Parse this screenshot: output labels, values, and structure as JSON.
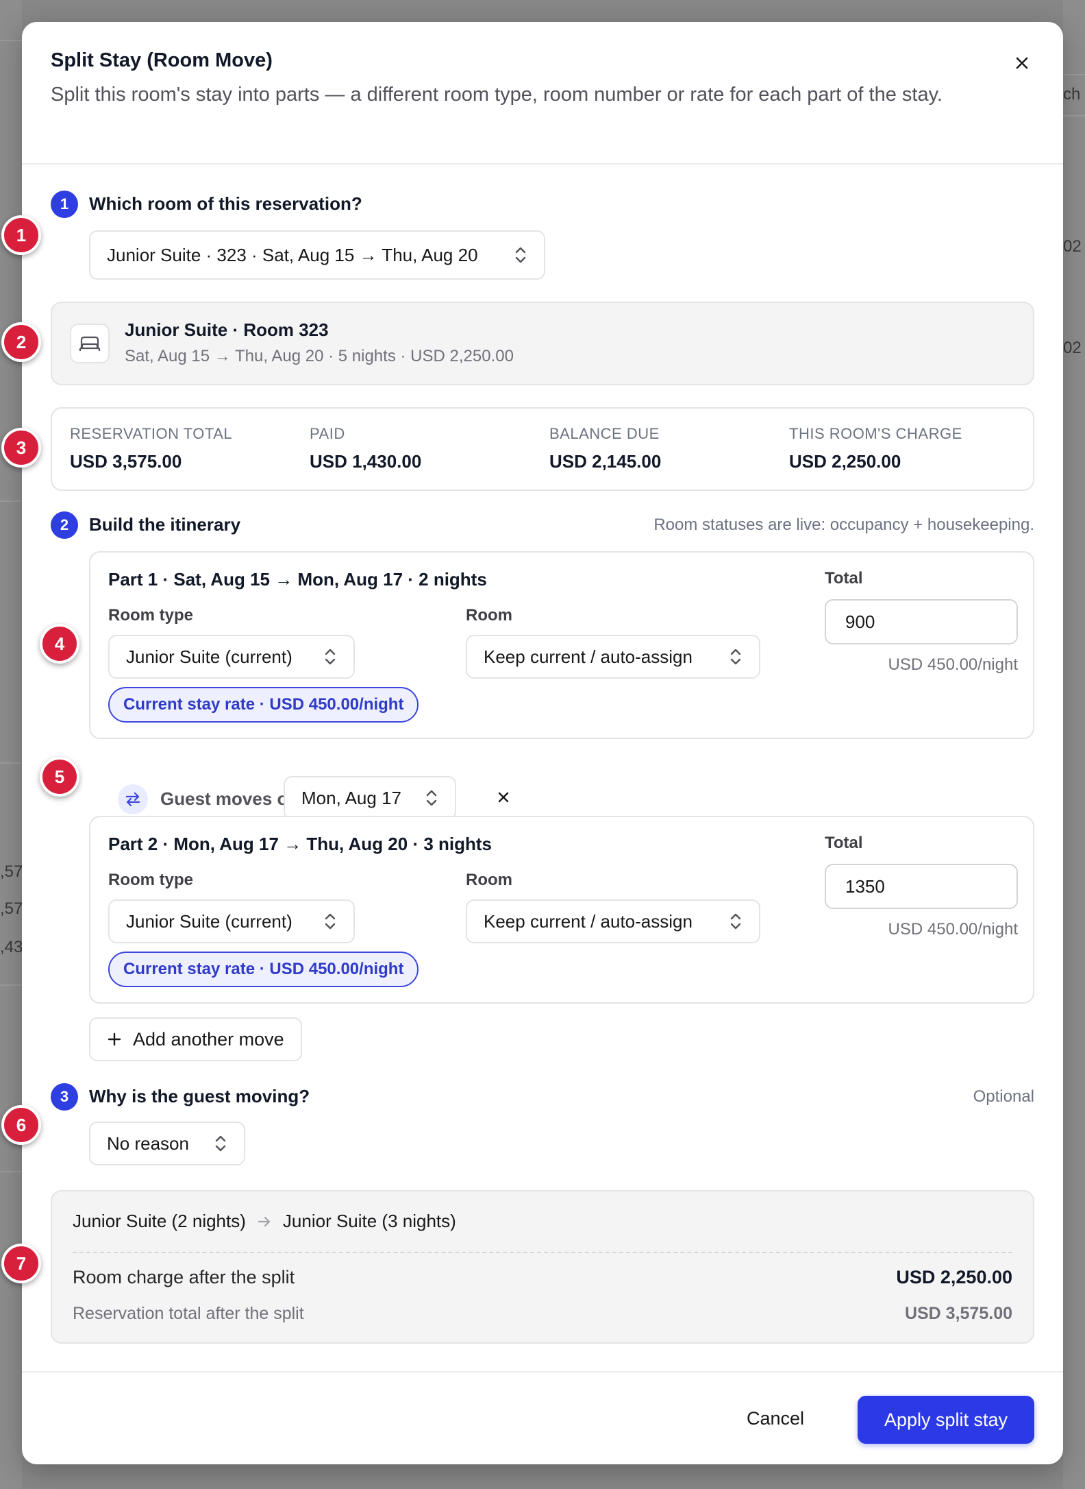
{
  "background": {
    "fragments": [
      "ch",
      "02",
      "02",
      ",57",
      ",57",
      ",43"
    ]
  },
  "modal": {
    "title": "Split Stay (Room Move)",
    "subtitle": "Split this room's stay into parts — a different room type, room number or rate for each part of the stay."
  },
  "step1": {
    "number": "1",
    "title": "Which room of this reservation?",
    "room_select": "Junior Suite · 323 · Sat, Aug 15 → Thu, Aug 20"
  },
  "room_card": {
    "name": "Junior Suite · Room 323",
    "meta": "Sat, Aug 15 → Thu, Aug 20 · 5 nights · USD 2,250.00"
  },
  "totals": [
    {
      "label": "RESERVATION TOTAL",
      "value": "USD 3,575.00"
    },
    {
      "label": "PAID",
      "value": "USD 1,430.00"
    },
    {
      "label": "BALANCE DUE",
      "value": "USD 2,145.00"
    },
    {
      "label": "THIS ROOM'S CHARGE",
      "value": "USD 2,250.00"
    }
  ],
  "step2": {
    "number": "2",
    "title": "Build the itinerary",
    "note": "Room statuses are live: occupancy + housekeeping."
  },
  "parts": [
    {
      "title": "Part 1 · Sat, Aug 15 → Mon, Aug 17 · 2 nights",
      "room_type_label": "Room type",
      "room_type": "Junior Suite (current)",
      "room_label": "Room",
      "room": "Keep current / auto-assign",
      "total_label": "Total",
      "total": "900",
      "per_night": "USD 450.00/night",
      "rate_pill": "Current stay rate · USD 450.00/night"
    },
    {
      "title": "Part 2 · Mon, Aug 17 → Thu, Aug 20 · 3 nights",
      "room_type_label": "Room type",
      "room_type": "Junior Suite (current)",
      "room_label": "Room",
      "room": "Keep current / auto-assign",
      "total_label": "Total",
      "total": "1350",
      "per_night": "USD 450.00/night",
      "rate_pill": "Current stay rate · USD 450.00/night"
    }
  ],
  "move": {
    "label": "Guest moves on",
    "date": "Mon, Aug 17"
  },
  "add_move": "Add another move",
  "step3": {
    "number": "3",
    "title": "Why is the guest moving?",
    "optional": "Optional",
    "reason": "No reason"
  },
  "summary": {
    "from": "Junior Suite (2 nights)",
    "to": "Junior Suite (3 nights)",
    "room_charge_label": "Room charge after the split",
    "room_charge_value": "USD 2,250.00",
    "reservation_total_label": "Reservation total after the split",
    "reservation_total_value": "USD 3,575.00"
  },
  "footer": {
    "cancel": "Cancel",
    "apply": "Apply split stay"
  },
  "markers": [
    "1",
    "2",
    "3",
    "4",
    "5",
    "6",
    "7"
  ],
  "colors": {
    "accent": "#2b3ae6",
    "marker": "#d81f3c",
    "overlay": "#878787"
  },
  "icons": {
    "close": "close-icon",
    "bed": "bed-icon",
    "chevron": "chevron-up-down-icon",
    "swap": "swap-icon",
    "plus": "plus-icon",
    "arrow": "arrow-right-icon"
  }
}
